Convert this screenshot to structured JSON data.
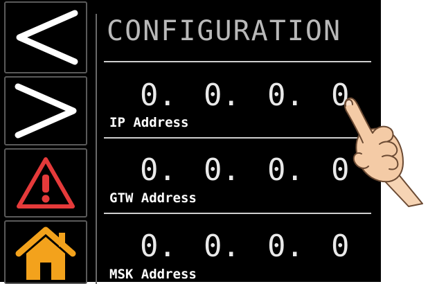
{
  "header": {
    "title": "CONFIGURATION"
  },
  "nav": {
    "items": [
      {
        "icon": "chevron-left-icon"
      },
      {
        "icon": "chevron-right-icon"
      },
      {
        "icon": "warning-icon"
      },
      {
        "icon": "home-icon"
      }
    ]
  },
  "fields": [
    {
      "label": "IP Address",
      "octets": [
        "0.",
        "0.",
        "0.",
        "0"
      ]
    },
    {
      "label": "GTW Address",
      "octets": [
        "0.",
        "0.",
        "0.",
        "0"
      ]
    },
    {
      "label": "MSK Address",
      "octets": [
        "0.",
        "0.",
        "0.",
        "0"
      ]
    }
  ],
  "colors": {
    "background": "#000000",
    "title": "#b9b9b9",
    "text": "#ffffff",
    "warning": "#e53a3a",
    "home": "#f3a21c"
  }
}
